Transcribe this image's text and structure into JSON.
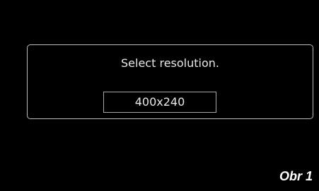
{
  "dialog": {
    "prompt": "Select resolution.",
    "selected_resolution": "400x240"
  },
  "caption": "Obr 1"
}
